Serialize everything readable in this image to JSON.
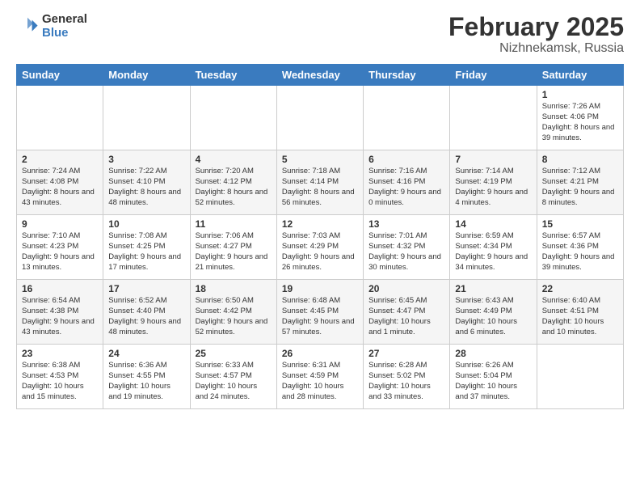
{
  "logo": {
    "general": "General",
    "blue": "Blue"
  },
  "header": {
    "month": "February 2025",
    "location": "Nizhnekamsk, Russia"
  },
  "weekdays": [
    "Sunday",
    "Monday",
    "Tuesday",
    "Wednesday",
    "Thursday",
    "Friday",
    "Saturday"
  ],
  "weeks": [
    [
      {
        "day": "",
        "info": ""
      },
      {
        "day": "",
        "info": ""
      },
      {
        "day": "",
        "info": ""
      },
      {
        "day": "",
        "info": ""
      },
      {
        "day": "",
        "info": ""
      },
      {
        "day": "",
        "info": ""
      },
      {
        "day": "1",
        "info": "Sunrise: 7:26 AM\nSunset: 4:06 PM\nDaylight: 8 hours and 39 minutes."
      }
    ],
    [
      {
        "day": "2",
        "info": "Sunrise: 7:24 AM\nSunset: 4:08 PM\nDaylight: 8 hours and 43 minutes."
      },
      {
        "day": "3",
        "info": "Sunrise: 7:22 AM\nSunset: 4:10 PM\nDaylight: 8 hours and 48 minutes."
      },
      {
        "day": "4",
        "info": "Sunrise: 7:20 AM\nSunset: 4:12 PM\nDaylight: 8 hours and 52 minutes."
      },
      {
        "day": "5",
        "info": "Sunrise: 7:18 AM\nSunset: 4:14 PM\nDaylight: 8 hours and 56 minutes."
      },
      {
        "day": "6",
        "info": "Sunrise: 7:16 AM\nSunset: 4:16 PM\nDaylight: 9 hours and 0 minutes."
      },
      {
        "day": "7",
        "info": "Sunrise: 7:14 AM\nSunset: 4:19 PM\nDaylight: 9 hours and 4 minutes."
      },
      {
        "day": "8",
        "info": "Sunrise: 7:12 AM\nSunset: 4:21 PM\nDaylight: 9 hours and 8 minutes."
      }
    ],
    [
      {
        "day": "9",
        "info": "Sunrise: 7:10 AM\nSunset: 4:23 PM\nDaylight: 9 hours and 13 minutes."
      },
      {
        "day": "10",
        "info": "Sunrise: 7:08 AM\nSunset: 4:25 PM\nDaylight: 9 hours and 17 minutes."
      },
      {
        "day": "11",
        "info": "Sunrise: 7:06 AM\nSunset: 4:27 PM\nDaylight: 9 hours and 21 minutes."
      },
      {
        "day": "12",
        "info": "Sunrise: 7:03 AM\nSunset: 4:29 PM\nDaylight: 9 hours and 26 minutes."
      },
      {
        "day": "13",
        "info": "Sunrise: 7:01 AM\nSunset: 4:32 PM\nDaylight: 9 hours and 30 minutes."
      },
      {
        "day": "14",
        "info": "Sunrise: 6:59 AM\nSunset: 4:34 PM\nDaylight: 9 hours and 34 minutes."
      },
      {
        "day": "15",
        "info": "Sunrise: 6:57 AM\nSunset: 4:36 PM\nDaylight: 9 hours and 39 minutes."
      }
    ],
    [
      {
        "day": "16",
        "info": "Sunrise: 6:54 AM\nSunset: 4:38 PM\nDaylight: 9 hours and 43 minutes."
      },
      {
        "day": "17",
        "info": "Sunrise: 6:52 AM\nSunset: 4:40 PM\nDaylight: 9 hours and 48 minutes."
      },
      {
        "day": "18",
        "info": "Sunrise: 6:50 AM\nSunset: 4:42 PM\nDaylight: 9 hours and 52 minutes."
      },
      {
        "day": "19",
        "info": "Sunrise: 6:48 AM\nSunset: 4:45 PM\nDaylight: 9 hours and 57 minutes."
      },
      {
        "day": "20",
        "info": "Sunrise: 6:45 AM\nSunset: 4:47 PM\nDaylight: 10 hours and 1 minute."
      },
      {
        "day": "21",
        "info": "Sunrise: 6:43 AM\nSunset: 4:49 PM\nDaylight: 10 hours and 6 minutes."
      },
      {
        "day": "22",
        "info": "Sunrise: 6:40 AM\nSunset: 4:51 PM\nDaylight: 10 hours and 10 minutes."
      }
    ],
    [
      {
        "day": "23",
        "info": "Sunrise: 6:38 AM\nSunset: 4:53 PM\nDaylight: 10 hours and 15 minutes."
      },
      {
        "day": "24",
        "info": "Sunrise: 6:36 AM\nSunset: 4:55 PM\nDaylight: 10 hours and 19 minutes."
      },
      {
        "day": "25",
        "info": "Sunrise: 6:33 AM\nSunset: 4:57 PM\nDaylight: 10 hours and 24 minutes."
      },
      {
        "day": "26",
        "info": "Sunrise: 6:31 AM\nSunset: 4:59 PM\nDaylight: 10 hours and 28 minutes."
      },
      {
        "day": "27",
        "info": "Sunrise: 6:28 AM\nSunset: 5:02 PM\nDaylight: 10 hours and 33 minutes."
      },
      {
        "day": "28",
        "info": "Sunrise: 6:26 AM\nSunset: 5:04 PM\nDaylight: 10 hours and 37 minutes."
      },
      {
        "day": "",
        "info": ""
      }
    ]
  ]
}
